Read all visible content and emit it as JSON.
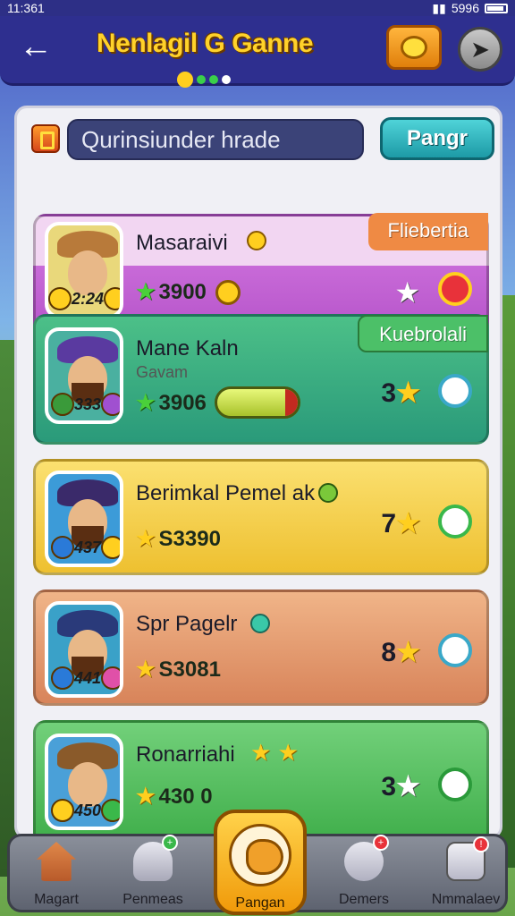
{
  "status_bar": {
    "time": "11:361",
    "right_text": "5996"
  },
  "header": {
    "title": "Nenlagil G Ganne",
    "back_icon": "back-arrow-icon",
    "coins_icon": "coin-stack-icon",
    "nav_icon": "compass-icon"
  },
  "search": {
    "placeholder": "Qurinsiunder hrade",
    "button_label": "Pangr",
    "icon": "trophy-icon"
  },
  "players": [
    {
      "name": "Masaraivi",
      "score": "3900",
      "level": "2:24",
      "tag": "Fliebertia",
      "bg": "#cf72e2",
      "tag_bg": "#ef8a44",
      "avatar_bg": "#e9d87b",
      "rank": "",
      "extra": "coin"
    },
    {
      "name": "Mane Kaln",
      "sub": "Gavam",
      "score": "3906",
      "level": "333",
      "tag": "Kuebrolali",
      "bg": "#3fb890",
      "tag_bg": "#4cc068",
      "avatar_bg": "#4ab0a0",
      "rank": "3",
      "extra": "progress"
    },
    {
      "name": "Berimkal Pemel ak",
      "score": "S3390",
      "level": "437",
      "bg": "#f6d04a",
      "avatar_bg": "#3c9bd8",
      "rank": "7",
      "extra": ""
    },
    {
      "name": "Spr Pagelr",
      "score": "S3081",
      "level": "441",
      "bg": "#e8a473",
      "avatar_bg": "#3aa1c8",
      "rank": "8",
      "extra": ""
    },
    {
      "name": "Ronarriahi",
      "score": "430 0",
      "level": "450",
      "bg": "#62c66a",
      "avatar_bg": "#4aa0d8",
      "rank": "3",
      "extra": ""
    }
  ],
  "bottom_nav": [
    {
      "label": "Magart",
      "icon": "house-icon"
    },
    {
      "label": "Penmeas",
      "icon": "players-icon"
    },
    {
      "label": "Pangan",
      "icon": "magic-bag-icon"
    },
    {
      "label": "Demers",
      "icon": "chat-icon"
    },
    {
      "label": "Nmmalaev",
      "icon": "dice-icon"
    }
  ]
}
